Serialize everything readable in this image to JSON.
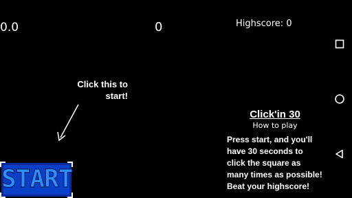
{
  "hud": {
    "timer": "0.0",
    "score": "0",
    "highscore": "Highscore: 0"
  },
  "hint": {
    "text": "Click this to\nstart!"
  },
  "start_button": {
    "label": "START",
    "fill_color": "#0a3fc8",
    "text_color": "#2f8fff"
  },
  "help": {
    "title": "Click'in 30",
    "subtitle": "How to play",
    "body": "Press start, and you'll have 30 seconds to click the square as many times as possible! Beat your highscore!"
  },
  "navigation_bar": {
    "icons": [
      "recent-apps-icon",
      "home-icon",
      "back-icon"
    ]
  }
}
